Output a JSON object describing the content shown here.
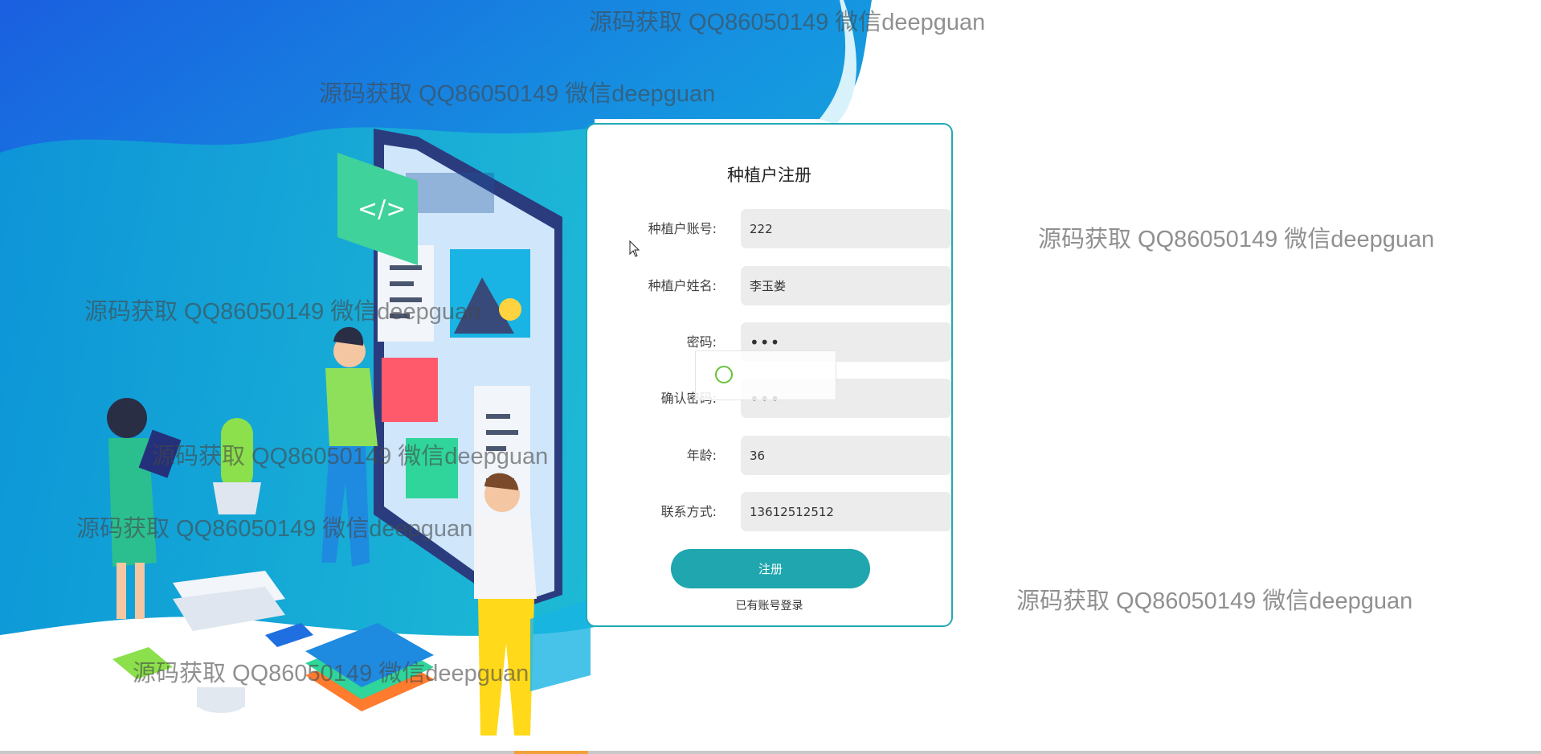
{
  "form": {
    "title": "种植户注册",
    "fields": [
      {
        "label": "种植户账号:",
        "value": "222",
        "type": "text"
      },
      {
        "label": "种植户姓名:",
        "value": "李玉娄",
        "type": "text"
      },
      {
        "label": "密码:",
        "value": "•••",
        "type": "password"
      },
      {
        "label": "确认密码:",
        "value": "•••",
        "type": "password"
      },
      {
        "label": "年龄:",
        "value": "36",
        "type": "text"
      },
      {
        "label": "联系方式:",
        "value": "13612512512",
        "type": "text"
      }
    ],
    "submit_label": "注册",
    "login_link": "已有账号登录"
  },
  "watermark": "源码获取 QQ86050149 微信deepguan",
  "colors": {
    "accent": "#1fa6ae",
    "card_border": "#21a9b6",
    "input_bg": "#ececec",
    "background_blue_dark": "#1a79e6",
    "background_cyan": "#16b3d3"
  }
}
